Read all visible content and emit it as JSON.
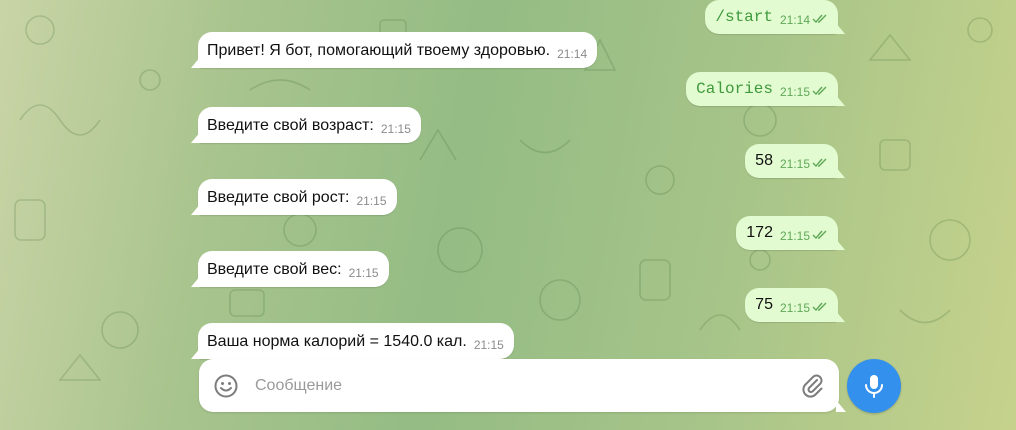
{
  "colors": {
    "accent": "#3390ec",
    "outgoing_bubble": "#e3fbd0",
    "incoming_bubble": "#ffffff",
    "time_outgoing": "#5fa857"
  },
  "messages": [
    {
      "dir": "out",
      "text": "/start",
      "time": "21:14",
      "mono": true,
      "read": true
    },
    {
      "dir": "in",
      "text": "Привет! Я бот, помогающий твоему здоровью.",
      "time": "21:14"
    },
    {
      "dir": "out",
      "text": "Calories",
      "time": "21:15",
      "mono": true,
      "read": true
    },
    {
      "dir": "in",
      "text": "Введите свой возраст:",
      "time": "21:15"
    },
    {
      "dir": "out",
      "text": "58",
      "time": "21:15",
      "read": true
    },
    {
      "dir": "in",
      "text": "Введите свой рост:",
      "time": "21:15"
    },
    {
      "dir": "out",
      "text": "172",
      "time": "21:15",
      "read": true
    },
    {
      "dir": "in",
      "text": "Введите свой вес:",
      "time": "21:15"
    },
    {
      "dir": "out",
      "text": "75",
      "time": "21:15",
      "read": true
    },
    {
      "dir": "in",
      "text": "Ваша норма калорий = 1540.0 кал.",
      "time": "21:15"
    }
  ],
  "composer": {
    "placeholder": "Сообщение",
    "emoji_icon": "smile-icon",
    "attach_icon": "paperclip-icon",
    "mic_icon": "microphone-icon"
  }
}
